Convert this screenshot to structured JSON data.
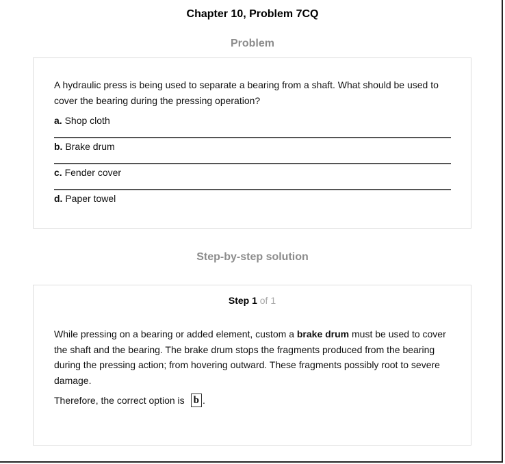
{
  "header": {
    "title": "Chapter 10, Problem 7CQ"
  },
  "problem": {
    "section_label": "Problem",
    "question": "A hydraulic press is being used to separate a bearing from a shaft. What should be used to cover the bearing during the pressing operation?",
    "options": [
      {
        "letter": "a.",
        "text": "Shop cloth"
      },
      {
        "letter": "b.",
        "text": "Brake drum"
      },
      {
        "letter": "c.",
        "text": "Fender cover"
      },
      {
        "letter": "d.",
        "text": "Paper towel"
      }
    ]
  },
  "solution": {
    "section_label": "Step-by-step solution",
    "step_label": "Step 1",
    "step_of": "of 1",
    "text_before": "While pressing on a bearing or added element, custom a ",
    "text_bold": "brake drum",
    "text_after": " must be used to cover the shaft and the bearing. The brake drum stops the fragments produced from the bearing during the pressing action; from hovering outward. These fragments possibly root to severe damage.",
    "conclusion": "Therefore, the correct option is",
    "answer": "b",
    "terminal": "."
  }
}
